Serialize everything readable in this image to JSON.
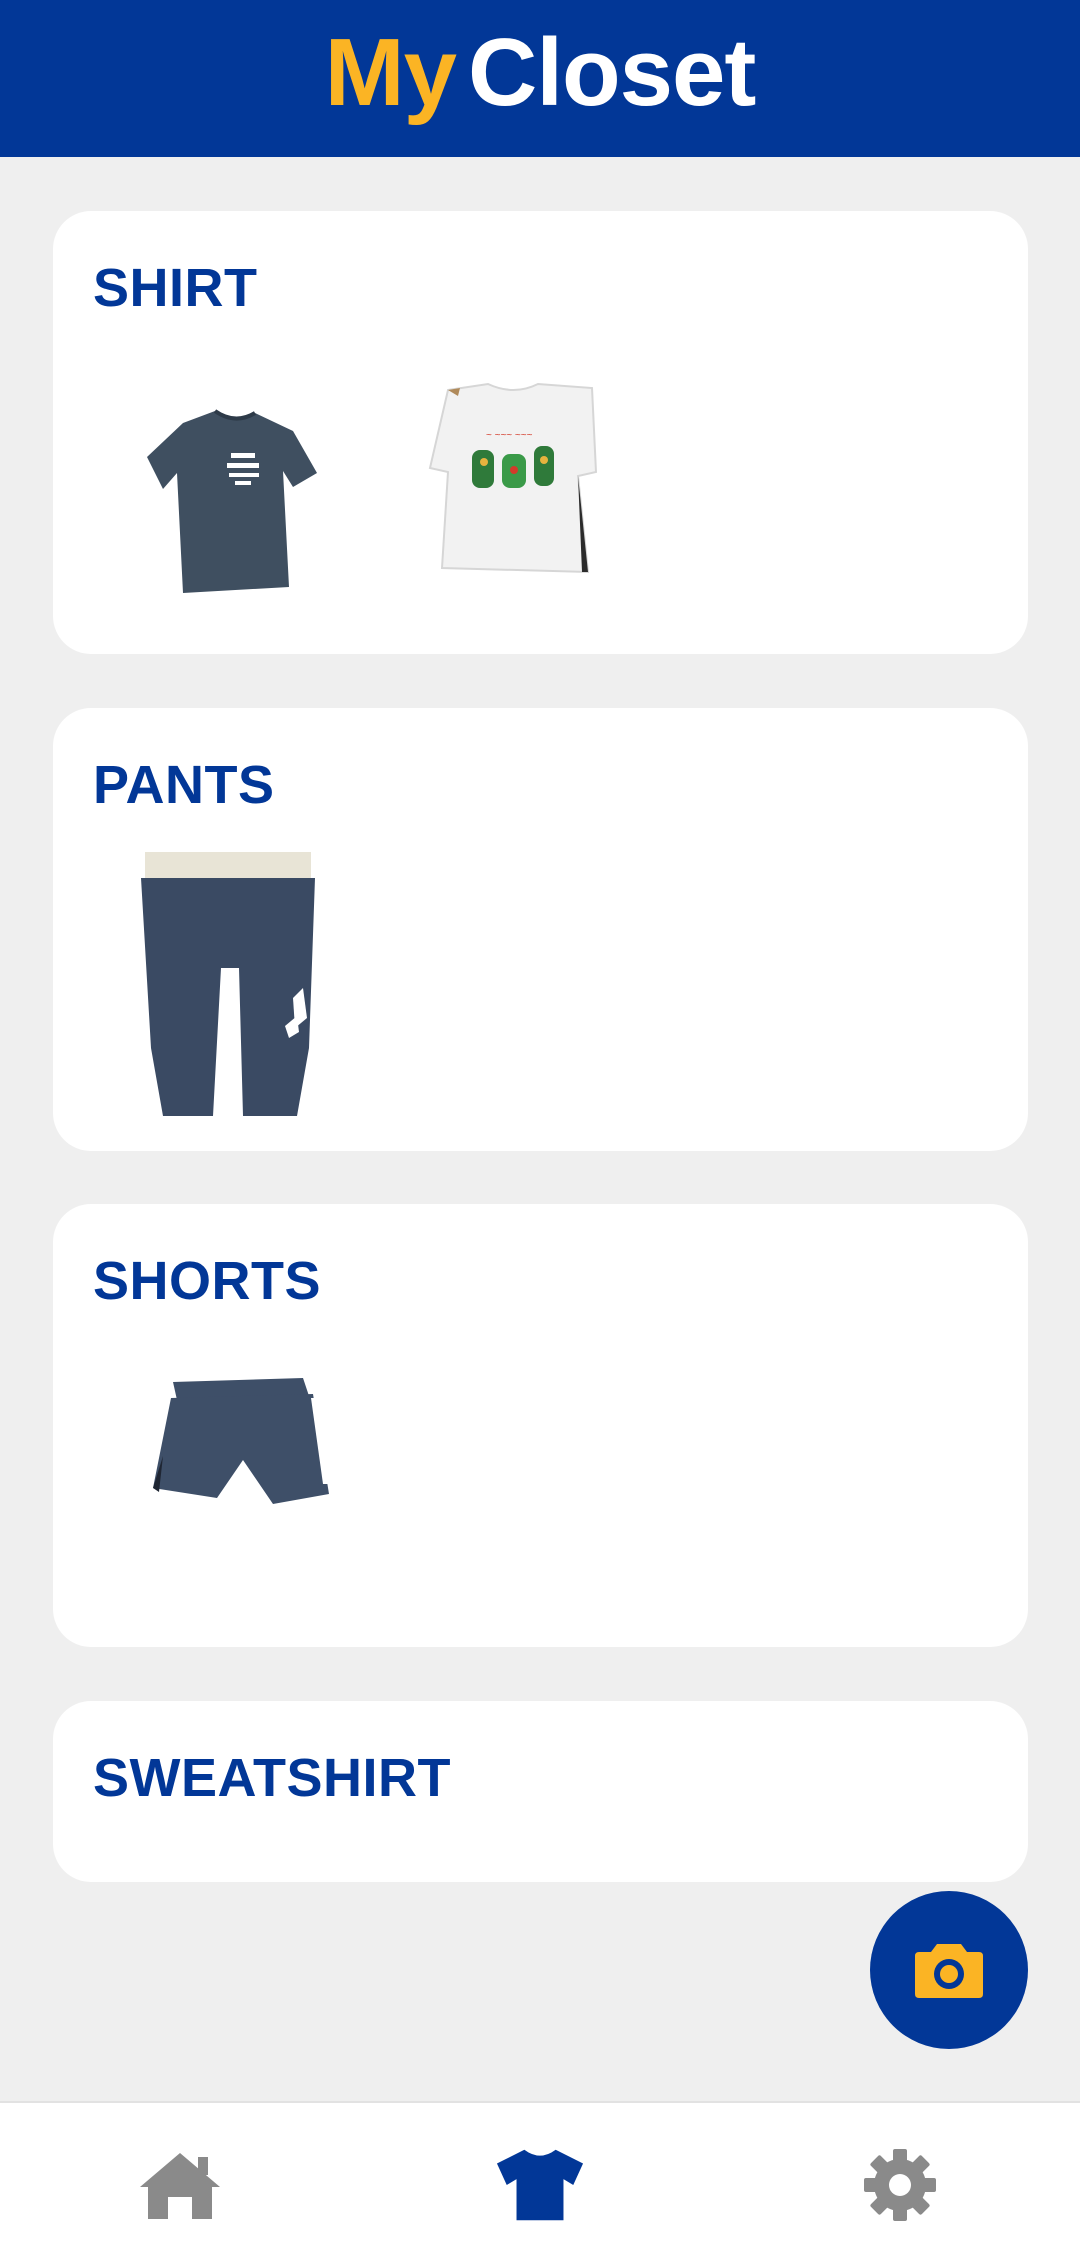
{
  "header": {
    "title_part1": "My",
    "title_part2": "Closet",
    "title_part1_color": "#fbb424",
    "title_part2_color": "#ffffff",
    "background_color": "#023797"
  },
  "categories": [
    {
      "label": "SHIRT",
      "items": [
        {
          "icon": "dark-gray-tshirt-image"
        },
        {
          "icon": "white-tshirt-image"
        }
      ]
    },
    {
      "label": "PANTS",
      "items": [
        {
          "icon": "navy-sweatpants-image"
        }
      ]
    },
    {
      "label": "SHORTS",
      "items": [
        {
          "icon": "navy-shorts-image"
        }
      ]
    },
    {
      "label": "SWEATSHIRT",
      "items": []
    }
  ],
  "fab": {
    "icon": "camera-icon",
    "background_color": "#023797",
    "icon_color": "#fbb424"
  },
  "bottom_nav": {
    "items": [
      {
        "icon": "home-icon",
        "active": false
      },
      {
        "icon": "tshirt-icon",
        "active": true
      },
      {
        "icon": "gear-icon",
        "active": false
      }
    ],
    "active_color": "#023797",
    "inactive_color": "#8a8a8a"
  }
}
